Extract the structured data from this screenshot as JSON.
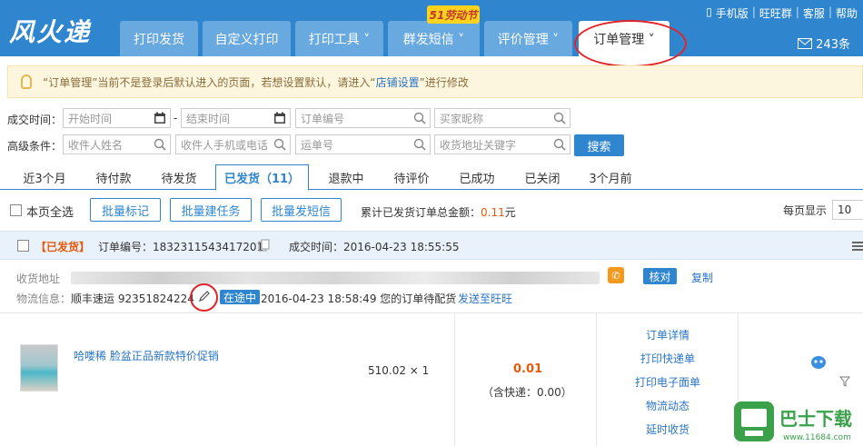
{
  "header": {
    "logo": "风火递",
    "nav": [
      {
        "label": "打印发货"
      },
      {
        "label": "自定义打印"
      },
      {
        "label": "打印工具 ˅"
      },
      {
        "label": "群发短信 ˅"
      },
      {
        "label": "评价管理 ˅"
      },
      {
        "label": "订单管理 ˅"
      }
    ],
    "badge": "51劳动节",
    "links": [
      "手机版",
      "旺旺群",
      "客服",
      "帮助"
    ],
    "message_count": "243条"
  },
  "notice": {
    "text_before": "“订单管理”当前不是登录后默认进入的页面，若想设置默认，请进入“",
    "link": "店铺设置",
    "text_after": "”进行修改"
  },
  "filters": {
    "deal_time_label": "成交时间：",
    "start_placeholder": "开始时间",
    "dash": "-",
    "end_placeholder": "结束时间",
    "order_no_placeholder": "订单编号",
    "buyer_nick_placeholder": "买家昵称",
    "advanced_label": "高级条件：",
    "receiver_name_placeholder": "收件人姓名",
    "receiver_phone_placeholder": "收件人手机或电话",
    "waybill_placeholder": "运单号",
    "address_kw_placeholder": "收货地址关键字",
    "search_button": "搜索"
  },
  "tabs": [
    {
      "label": "近3个月"
    },
    {
      "label": "待付款"
    },
    {
      "label": "待发货"
    },
    {
      "label": "已发货（11）"
    },
    {
      "label": "退款中"
    },
    {
      "label": "待评价"
    },
    {
      "label": "已成功"
    },
    {
      "label": "已关闭"
    },
    {
      "label": "3个月前"
    }
  ],
  "toolbar": {
    "select_all": "本页全选",
    "batch_mark": "批量标记",
    "batch_task": "批量建任务",
    "batch_sms": "批量发短信",
    "total_label": "累计已发货订单总金额：",
    "total_value": "0.11",
    "total_unit": "元",
    "per_page_label": "每页显示",
    "per_page_value": "10"
  },
  "order": {
    "status": "【已发货】",
    "order_no_label": "订单编号：",
    "order_no": "1832311543417201",
    "deal_time_label": "成交时间：",
    "deal_time": "2016-04-23 18:55:55",
    "address_label": "收货地址",
    "verify_button": "核对",
    "copy_link": "复制",
    "logistics_label": "物流信息：",
    "carrier": "顺丰速运",
    "tracking_no": "92351824224",
    "in_transit": "在途中",
    "logistics_time": "2016-04-23 18:58:49",
    "logistics_status": "您的订单待配货",
    "send_wangwang": "发送至旺旺",
    "item_title": "哈喽稀 脸盆正品新款特价促销",
    "item_price_qty": "510.02 × 1",
    "amount": "0.01",
    "shipping_note": "（含快递：0.00）",
    "actions": [
      "订单详情",
      "打印快递单",
      "打印电子面单",
      "物流动态",
      "延时收货"
    ]
  },
  "colors": {
    "brand_blue": "#2f86cf",
    "highlight_red": "#e0262a",
    "amount_orange": "#e8590c"
  }
}
